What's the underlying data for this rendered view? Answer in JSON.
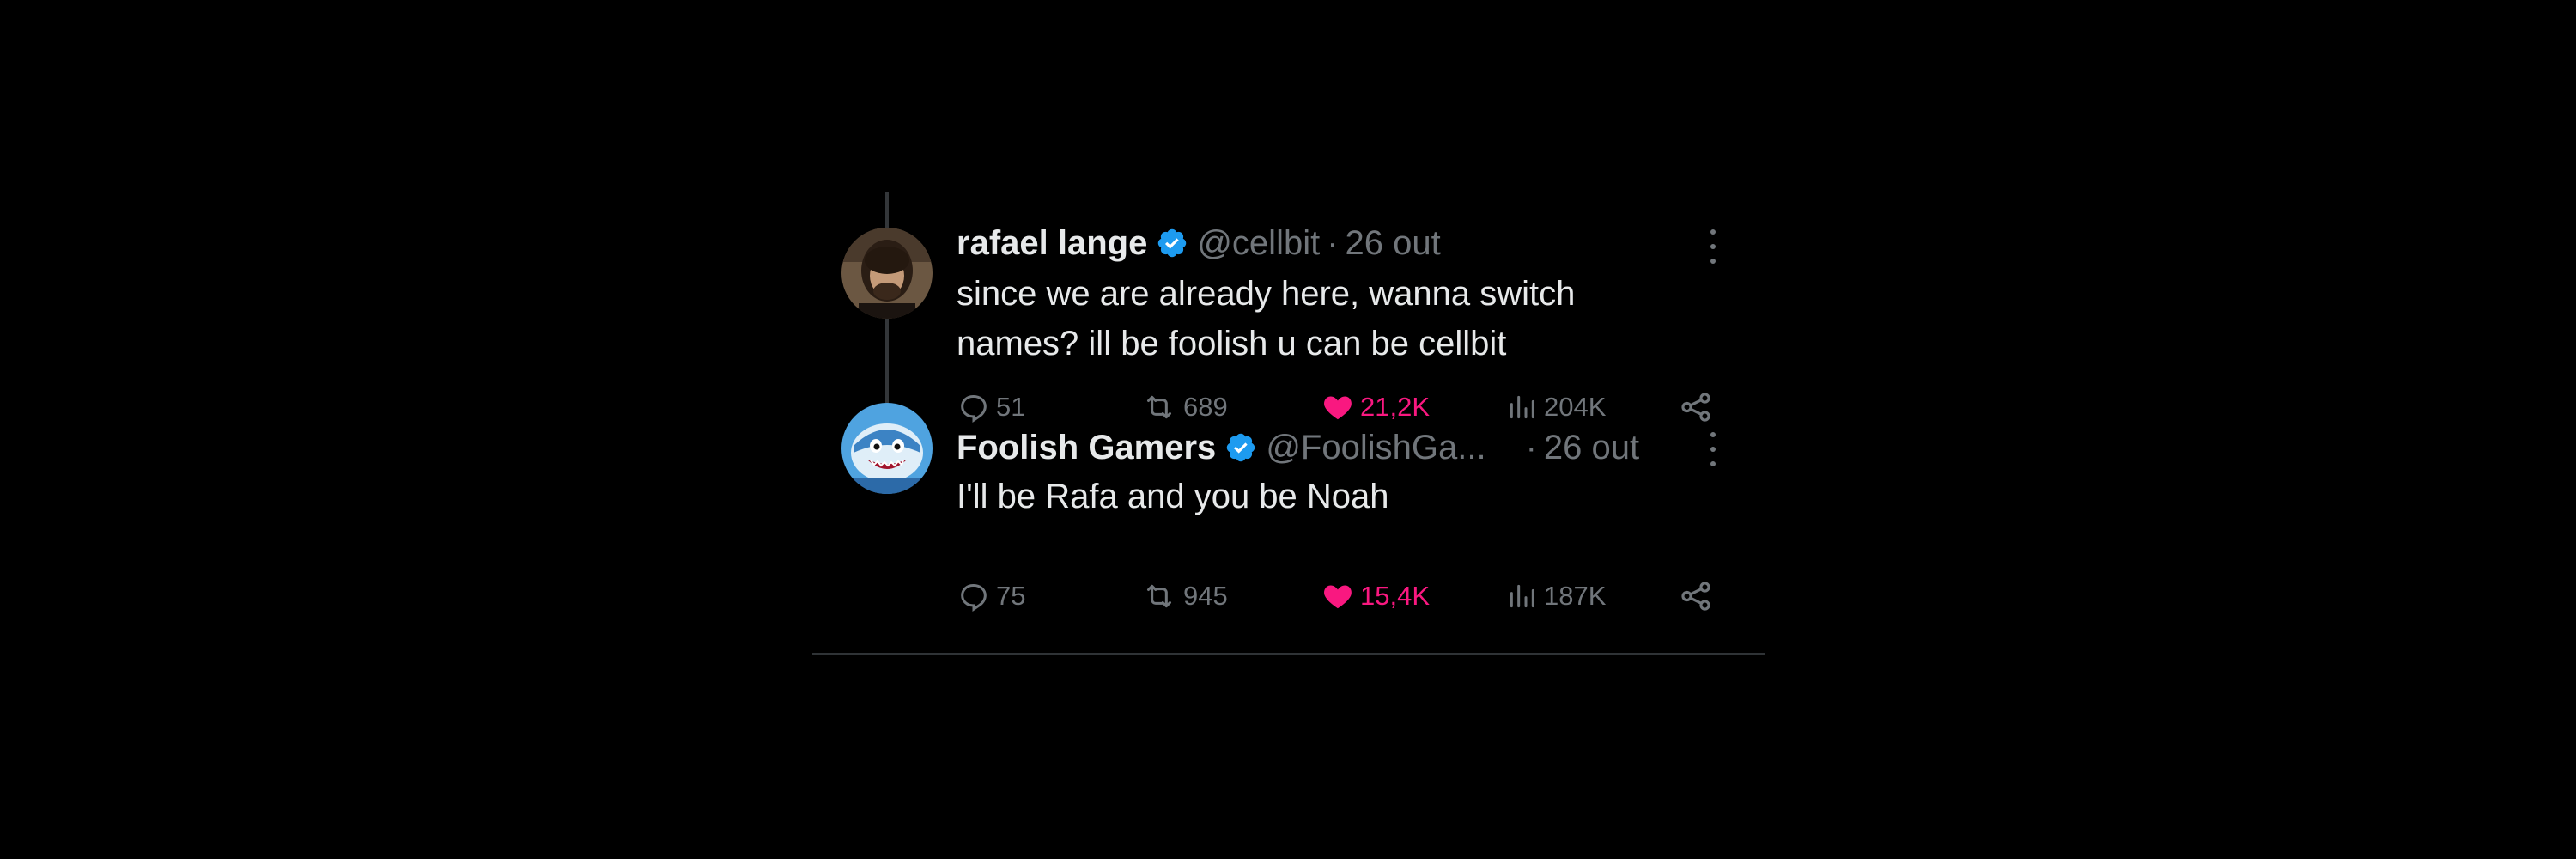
{
  "colors": {
    "background": "#000000",
    "text_primary": "#e7e9ea",
    "text_secondary": "#71767b",
    "like_active": "#f91880",
    "verified": "#1d9bf0",
    "thread_line": "#333639"
  },
  "tweets": [
    {
      "name": "rafael lange",
      "handle": "@cellbit",
      "dot": "·",
      "date": "26 out",
      "text_line1": "since we are already here, wanna switch",
      "text_line2": "names? ill be foolish u can be cellbit",
      "replies": "51",
      "retweets": "689",
      "likes": "21,2K",
      "views": "204K",
      "liked": true
    },
    {
      "name": "Foolish Gamers",
      "handle": "@FoolishGa...",
      "dot": "·",
      "date": "26 out",
      "text_line1": "I'll be Rafa and you be Noah",
      "replies": "75",
      "retweets": "945",
      "likes": "15,4K",
      "views": "187K",
      "liked": true
    }
  ],
  "icons": {
    "reply": "reply-icon",
    "retweet": "retweet-icon",
    "like": "heart-icon",
    "views": "views-icon",
    "share": "share-icon",
    "more": "more-options-icon",
    "verified": "verified-badge-icon"
  }
}
